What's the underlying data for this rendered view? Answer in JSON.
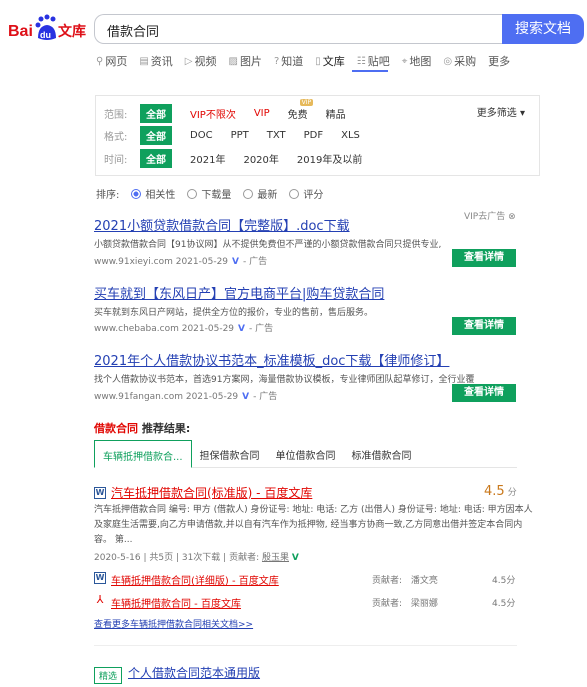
{
  "header": {
    "logo_text_left": "Bai",
    "logo_text_du": "du",
    "logo_text_right": "文库",
    "search_value": "借款合同",
    "search_button": "搜索文档"
  },
  "tabs": [
    {
      "icon": "search-icon",
      "glyph": "⚲",
      "label": "网页"
    },
    {
      "icon": "news-icon",
      "glyph": "▤",
      "label": "资讯"
    },
    {
      "icon": "video-icon",
      "glyph": "▷",
      "label": "视频"
    },
    {
      "icon": "image-icon",
      "glyph": "▨",
      "label": "图片"
    },
    {
      "icon": "question-icon",
      "glyph": "?",
      "label": "知道"
    },
    {
      "icon": "doc-icon",
      "glyph": "▯",
      "label": "文库"
    },
    {
      "icon": "forum-icon",
      "glyph": "☷",
      "label": "贴吧"
    },
    {
      "icon": "map-icon",
      "glyph": "⌖",
      "label": "地图"
    },
    {
      "icon": "shop-icon",
      "glyph": "◎",
      "label": "采购"
    },
    {
      "icon": "",
      "glyph": "",
      "label": "更多"
    }
  ],
  "filters": {
    "range_label": "范围:",
    "range_options": [
      "全部",
      "VIP不限次",
      "VIP",
      "免费",
      "精品"
    ],
    "vip_badge": "VIP",
    "format_label": "格式:",
    "format_options": [
      "全部",
      "DOC",
      "PPT",
      "TXT",
      "PDF",
      "XLS"
    ],
    "time_label": "时间:",
    "time_options": [
      "全部",
      "2021年",
      "2020年",
      "2019年及以前"
    ],
    "more": "更多筛选"
  },
  "sort": {
    "label": "排序:",
    "options": [
      "相关性",
      "下载量",
      "最新",
      "评分"
    ]
  },
  "ads": [
    {
      "title": "2021小额贷款借款合同【完整版】.doc下载",
      "desc": "小额贷款借款合同【91协议网】从不提供免费但不严谨的小额贷款借款合同只提供专业,",
      "url": "www.91xieyi.com",
      "date": "2021-05-29",
      "ad": "- 广告",
      "vip_note": "VIP去广告",
      "button": "查看详情"
    },
    {
      "title": "买车就到【东风日产】官方电商平台|购车贷款合同",
      "desc": "买车就到东风日产网站，提供全方位的报价，专业的售前，售后服务。",
      "url": "www.chebaba.com",
      "date": "2021-05-29",
      "ad": "- 广告",
      "button": "查看详情"
    },
    {
      "title": "2021年个人借款协议书范本_标准模板_doc下载【律师修订】",
      "desc": "找个人借款协议书范本，首选91方案网，海量借款协议模板，专业律师团队起草修订，全行业覆",
      "url": "www.91fangan.com",
      "date": "2021-05-29",
      "ad": "- 广告",
      "button": "查看详情"
    }
  ],
  "recommend": {
    "keyword": "借款合同",
    "head_suffix": "推荐结果:",
    "tabs": [
      "车辆抵押借款合...",
      "担保借款合同",
      "单位借款合同",
      "标准借款合同"
    ]
  },
  "main_result": {
    "title": "汽车抵押借款合同(标准版) - 百度文库",
    "rating": "4.5",
    "rating_unit": "分",
    "snippet_line1": "汽车抵押借款合同 编号: 甲方 (借款人) 身份证号: 地址: 电话: 乙方 (出借人) 身份证号: 地址: 电话: 甲方因本人",
    "snippet_line2": "及家庭生活需要,向乙方申请借款,并以自有汽车作为抵押物, 经当事方协商一致,乙方同意出借并签定本合同内",
    "snippet_line3": "容。 第...",
    "date": "2020-5-16",
    "pages": "共5页",
    "downloads": "31次下载",
    "contributor_label": "贡献者:",
    "contributor": "殷玉果"
  },
  "sub_results": [
    {
      "icon": "word",
      "title": "车辆抵押借款合同(详细版) - 百度文库",
      "contributor_label": "贡献者:",
      "contributor": "潘文亮",
      "rating": "4.5分"
    },
    {
      "icon": "pdf",
      "title": "车辆抵押借款合同 - 百度文库",
      "contributor_label": "贡献者:",
      "contributor": "梁丽娜",
      "rating": "4.5分"
    }
  ],
  "more_link": "查看更多车辆抵押借款合同相关文档>>",
  "last_result": {
    "tag": "精选",
    "title": "个人借款合同范本通用版"
  },
  "colors": {
    "accent": "#4e6ef2",
    "green": "#0fa05d",
    "red": "#e10602",
    "link": "#2440b3"
  }
}
